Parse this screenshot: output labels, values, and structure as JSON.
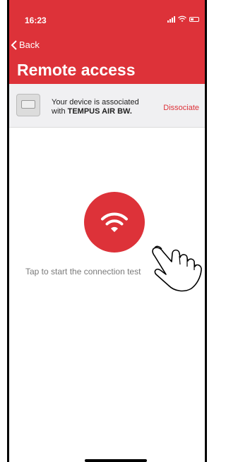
{
  "status": {
    "time": "16:23"
  },
  "nav": {
    "back_label": "Back",
    "title": "Remote access"
  },
  "device": {
    "line1": "Your device is associated",
    "line2_prefix": "with ",
    "device_name": "TEMPUS AIR BW.",
    "dissociate_label": "Dissociate"
  },
  "main": {
    "hint": "Tap to start the connection test"
  },
  "colors": {
    "accent": "#dd3239",
    "device_bar": "#f0f0f2"
  }
}
